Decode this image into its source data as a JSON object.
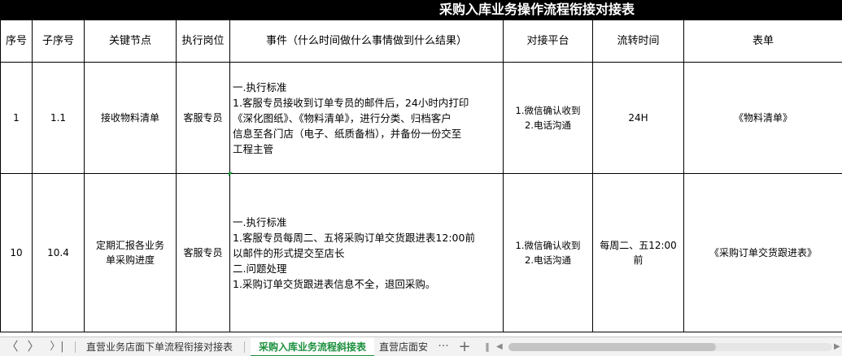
{
  "title": "采购入库业务操作流程衔接对接表",
  "headers": [
    "序号",
    "子序号",
    "关键节点",
    "执行岗位",
    "事件（什么时间做什么事情做到什么结果）",
    "对接平台",
    "流转时间",
    "表单"
  ],
  "rows": [
    {
      "no": "1",
      "sub_no": "1.1",
      "node": [
        "接收物料清单"
      ],
      "role": "客服专员",
      "event": [
        "一.执行标准",
        "1.客服专员接收到订单专员的邮件后，24小时内打印",
        "《深化图纸》、《物料清单》，进行分类、归档客户",
        "信息至各门店（电子、纸质备档），并备份一份交至",
        "工程主管"
      ],
      "platform": [
        "1.微信确认收到",
        "2.电话沟通"
      ],
      "time": [
        "24H"
      ],
      "form": "《物料清单》"
    },
    {
      "no": "10",
      "sub_no": "10.4",
      "node": [
        "定期汇报各业务",
        "单采购进度"
      ],
      "role": "客服专员",
      "event": [
        "一.执行标准",
        "1.客服专员每周二、五将采购订单交货跟进表12:00前",
        "以邮件的形式提交至店长",
        "二.问题处理",
        "1.采购订单交货跟进表信息不全，退回采购。"
      ],
      "platform": [
        "1.微信确认收到",
        "2.电话沟通"
      ],
      "time": [
        "每周二、五12:00",
        "前"
      ],
      "form": "《采购订单交货跟进表》"
    }
  ],
  "tabs": {
    "nav_first": "〈",
    "nav_prev": "〉",
    "nav_last": "〉|",
    "items": [
      "直营业务店面下单流程衔接对接表",
      "采购入库业务流程斜接表",
      "直营店面安"
    ],
    "more": "···",
    "add": "+",
    "split": "‖",
    "scroll_left": "◀",
    "scroll_right": "▶"
  },
  "colors": {
    "title_bg": "#000000",
    "title_fg": "#ffffff",
    "active_tab": "#1a8f3c",
    "marker": "#1a9c3b"
  }
}
